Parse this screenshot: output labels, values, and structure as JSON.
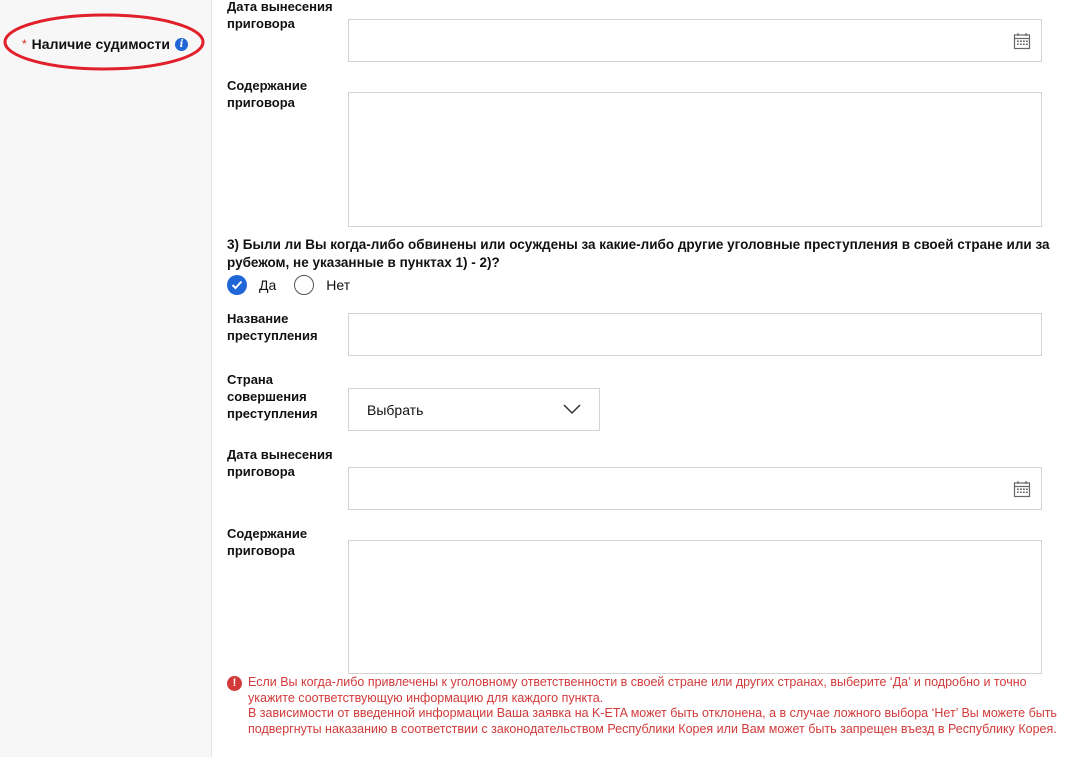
{
  "sidebar": {
    "required_mark": "*",
    "section_title": "Наличие судимости",
    "info_icon": "info-icon"
  },
  "block2": {
    "date_label": "Дата вынесения приговора",
    "content_label": "Содержание приговора"
  },
  "question3": {
    "text": "3) Были ли Вы когда-либо обвинены или осуждены за какие-либо другие уголовные преступления в своей стране или за рубежом, не указанные в пунктах 1) - 2)?",
    "options": [
      "Да",
      "Нет"
    ],
    "selected": "Да"
  },
  "block3": {
    "crime_name_label": "Название преступления",
    "country_label": "Страна совершения преступления",
    "country_select_value": "Выбрать",
    "date_label": "Дата вынесения приговора",
    "content_label": "Содержание приговора"
  },
  "warning": {
    "line1": "Если Вы когда-либо привлечены к уголовному ответственности в своей стране или других странах, выберите ‘Да’ и подробно и точно укажите соответствующую информацию для каждого пункта.",
    "line2": "В зависимости от введенной информации Ваша заявка на K-ETA может быть отклонена, а в случае ложного выбора ‘Нет’ Вы можете быть подвергнуты наказанию в соответствии с законодательством Республики Корея или Вам может быть запрещен въезд в Республику Корея."
  },
  "colors": {
    "accent": "#1f66d6",
    "required": "#d9261c",
    "warning": "#d23a3a",
    "annotation_ellipse": "#e0202a"
  }
}
